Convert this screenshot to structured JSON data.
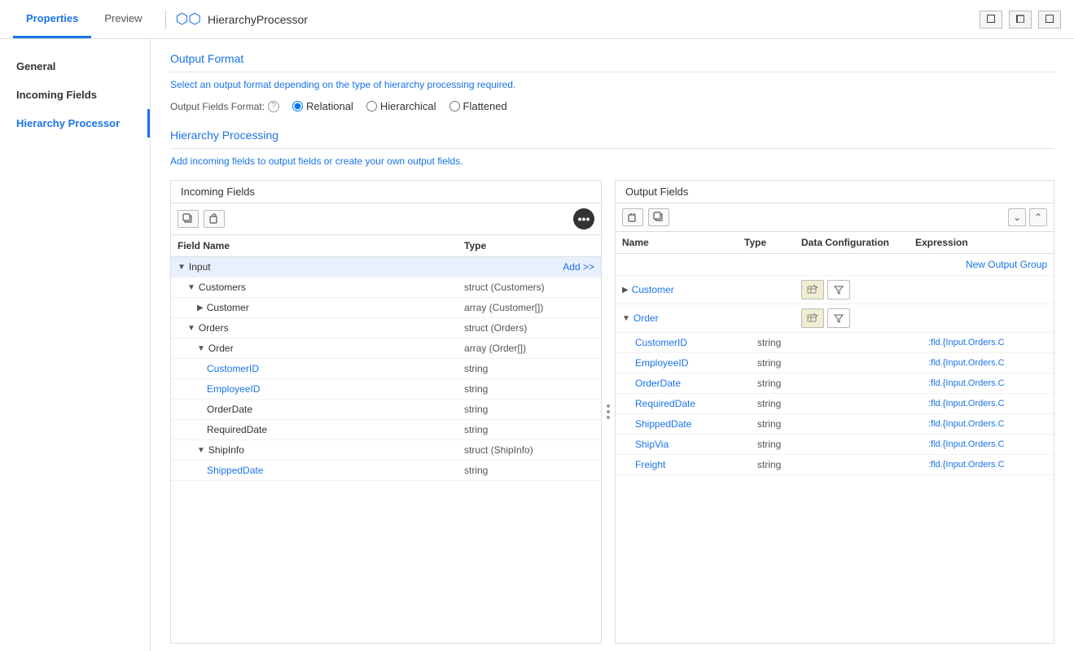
{
  "header": {
    "tabs": [
      {
        "label": "Properties",
        "active": true
      },
      {
        "label": "Preview",
        "active": false
      }
    ],
    "app_icon": "⬡",
    "app_title": "HierarchyProcessor"
  },
  "sidebar": {
    "items": [
      {
        "label": "General",
        "active": false
      },
      {
        "label": "Incoming Fields",
        "active": false
      },
      {
        "label": "Hierarchy Processor",
        "active": true
      }
    ]
  },
  "output_format": {
    "section_title": "Output Format",
    "description": "Select an output format depending on the type of hierarchy processing required.",
    "label": "Output Fields Format:",
    "options": [
      {
        "label": "Relational",
        "selected": true
      },
      {
        "label": "Hierarchical",
        "selected": false
      },
      {
        "label": "Flattened",
        "selected": false
      }
    ]
  },
  "hierarchy_processing": {
    "section_title": "Hierarchy Processing",
    "description": "Add incoming fields to output fields or create your own output fields."
  },
  "incoming_fields": {
    "pane_label": "Incoming Fields",
    "col_name": "Field Name",
    "col_type": "Type",
    "rows": [
      {
        "indent": 0,
        "chevron": "▼",
        "name": "Input",
        "type": "",
        "add": "Add >>",
        "selected": true,
        "name_style": "dark"
      },
      {
        "indent": 1,
        "chevron": "▼",
        "name": "Customers",
        "type": "struct (Customers)",
        "add": "",
        "selected": false,
        "name_style": "dark"
      },
      {
        "indent": 2,
        "chevron": "▶",
        "name": "Customer",
        "type": "array (Customer[])",
        "add": "",
        "selected": false,
        "name_style": "dark"
      },
      {
        "indent": 1,
        "chevron": "▼",
        "name": "Orders",
        "type": "struct (Orders)",
        "add": "",
        "selected": false,
        "name_style": "dark"
      },
      {
        "indent": 2,
        "chevron": "▼",
        "name": "Order",
        "type": "array (Order[])",
        "add": "",
        "selected": false,
        "name_style": "dark"
      },
      {
        "indent": 3,
        "chevron": "",
        "name": "CustomerID",
        "type": "string",
        "add": "",
        "selected": false,
        "name_style": "blue"
      },
      {
        "indent": 3,
        "chevron": "",
        "name": "EmployeeID",
        "type": "string",
        "add": "",
        "selected": false,
        "name_style": "blue"
      },
      {
        "indent": 3,
        "chevron": "",
        "name": "OrderDate",
        "type": "string",
        "add": "",
        "selected": false,
        "name_style": "dark"
      },
      {
        "indent": 3,
        "chevron": "",
        "name": "RequiredDate",
        "type": "string",
        "add": "",
        "selected": false,
        "name_style": "dark"
      },
      {
        "indent": 2,
        "chevron": "▼",
        "name": "ShipInfo",
        "type": "struct (ShipInfo)",
        "add": "",
        "selected": false,
        "name_style": "dark"
      },
      {
        "indent": 3,
        "chevron": "",
        "name": "ShippedDate",
        "type": "string",
        "add": "",
        "selected": false,
        "name_style": "blue"
      }
    ]
  },
  "output_fields": {
    "pane_label": "Output Fields",
    "col_name": "Name",
    "col_type": "Type",
    "col_config": "Data Configuration",
    "col_expr": "Expression",
    "new_group_label": "New Output Group",
    "rows": [
      {
        "type": "group",
        "chevron": "▶",
        "name": "Customer",
        "name_style": "blue",
        "has_config": true,
        "has_filter": true
      },
      {
        "type": "group",
        "chevron": "▼",
        "name": "Order",
        "name_style": "blue",
        "has_config": true,
        "has_filter": true
      },
      {
        "type": "field",
        "name": "CustomerID",
        "name_style": "blue",
        "field_type": "string",
        "type_style": "red",
        "expr": ":fld.{Input.Orders.C"
      },
      {
        "type": "field",
        "name": "EmployeeID",
        "name_style": "blue",
        "field_type": "string",
        "type_style": "red",
        "expr": ":fld.{Input.Orders.C"
      },
      {
        "type": "field",
        "name": "OrderDate",
        "name_style": "blue",
        "field_type": "string",
        "type_style": "red",
        "expr": ":fld.{Input.Orders.C"
      },
      {
        "type": "field",
        "name": "RequiredDate",
        "name_style": "blue",
        "field_type": "string",
        "type_style": "red",
        "expr": ":fld.{Input.Orders.C"
      },
      {
        "type": "field",
        "name": "ShippedDate",
        "name_style": "blue",
        "field_type": "string",
        "type_style": "red",
        "expr": ":fld.{Input.Orders.C"
      },
      {
        "type": "field",
        "name": "ShipVia",
        "name_style": "blue",
        "field_type": "string",
        "type_style": "red",
        "expr": ":fld.{Input.Orders.C"
      },
      {
        "type": "field",
        "name": "Freight",
        "name_style": "blue",
        "field_type": "string",
        "type_style": "red",
        "expr": ":fld.{Input.Orders.C"
      }
    ]
  }
}
